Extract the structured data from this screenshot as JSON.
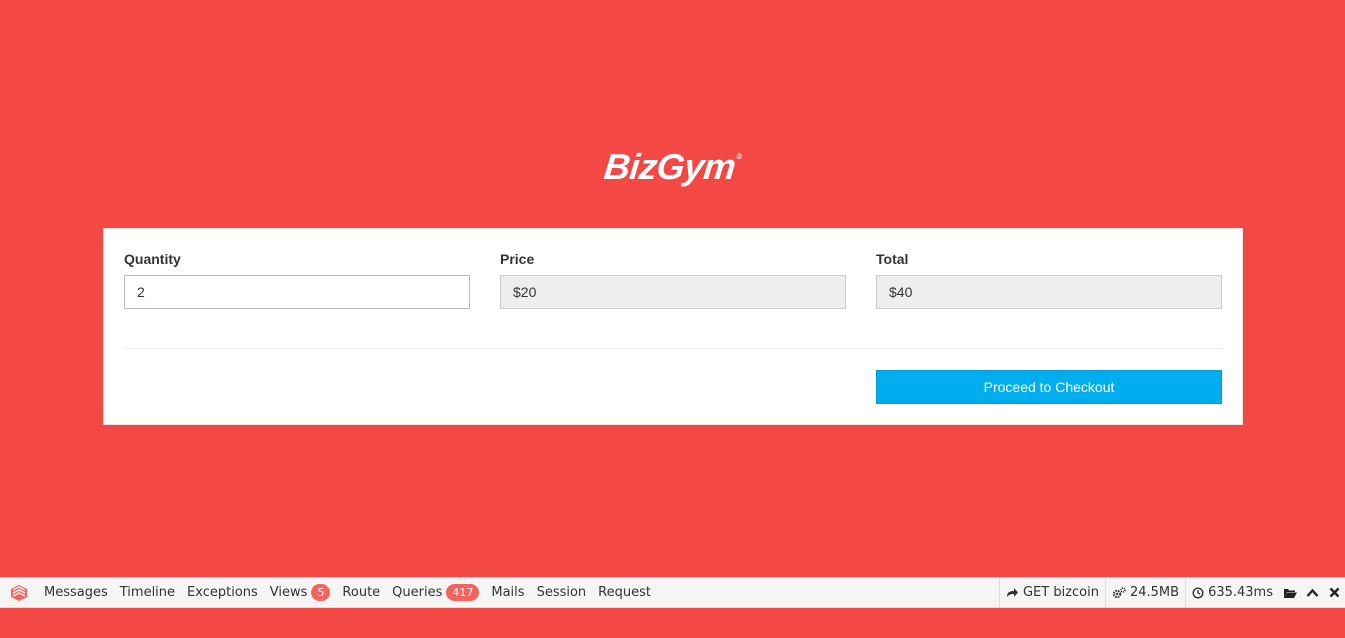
{
  "logo": {
    "text": "BizGym",
    "mark": "®"
  },
  "form": {
    "quantity": {
      "label": "Quantity",
      "value": "2"
    },
    "price": {
      "label": "Price",
      "value": "$20"
    },
    "total": {
      "label": "Total",
      "value": "$40"
    },
    "checkout_label": "Proceed to Checkout"
  },
  "debugbar": {
    "tabs": [
      {
        "label": "Messages"
      },
      {
        "label": "Timeline"
      },
      {
        "label": "Exceptions"
      },
      {
        "label": "Views",
        "badge": "5"
      },
      {
        "label": "Route"
      },
      {
        "label": "Queries",
        "badge": "417"
      },
      {
        "label": "Mails"
      },
      {
        "label": "Session"
      },
      {
        "label": "Request"
      }
    ],
    "request": "GET bizcoin",
    "memory": "24.5MB",
    "time": "635.43ms",
    "icons": [
      "laravel-logo-icon",
      "share-arrow-icon",
      "gears-icon",
      "clock-icon",
      "folder-open-icon",
      "chevron-up-icon",
      "close-icon"
    ]
  },
  "colors": {
    "background": "#f44844",
    "accent": "#00aeef",
    "badge": "#f4645f"
  }
}
